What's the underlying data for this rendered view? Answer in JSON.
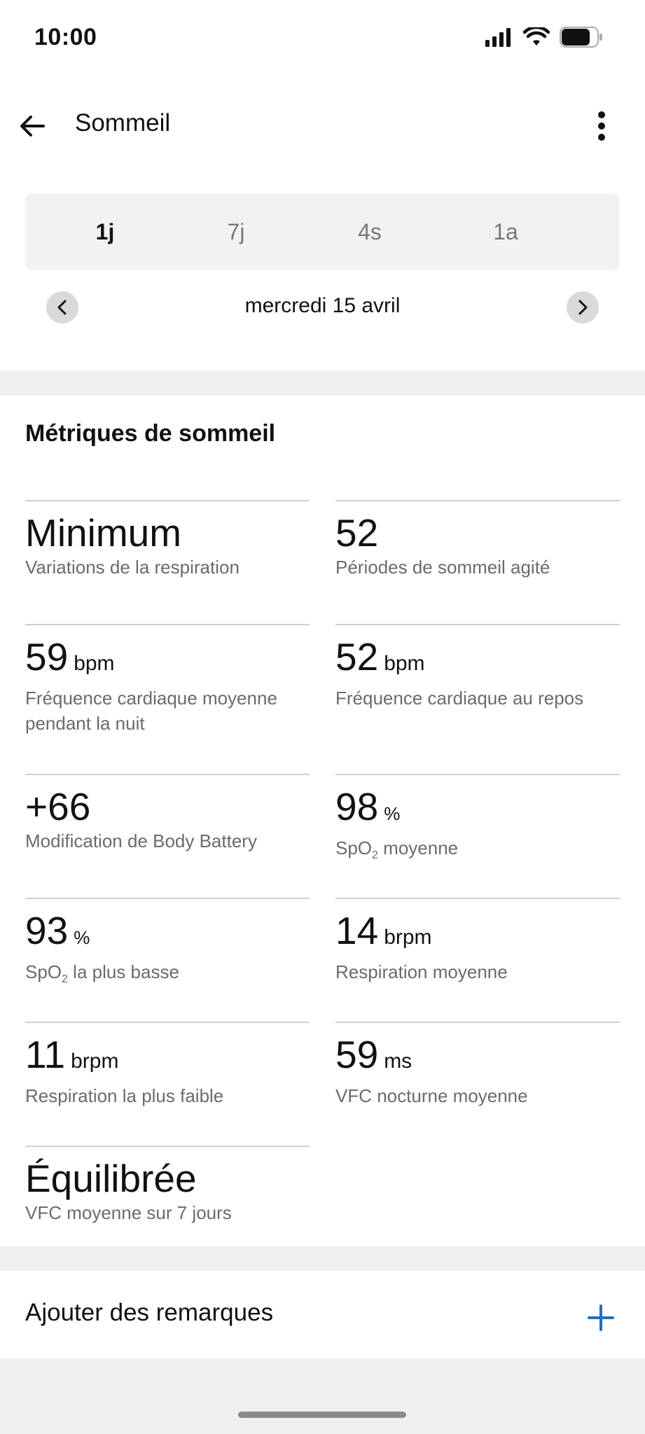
{
  "status_bar": {
    "time": "10:00"
  },
  "header": {
    "title": "Sommeil"
  },
  "periods": [
    {
      "label": "1j",
      "active": true
    },
    {
      "label": "7j",
      "active": false
    },
    {
      "label": "4s",
      "active": false
    },
    {
      "label": "1a",
      "active": false
    }
  ],
  "date_nav": {
    "date": "mercredi 15 avril"
  },
  "section": {
    "title": "Métriques de sommeil"
  },
  "metrics": [
    {
      "value": "Minimum",
      "unit": "",
      "label": "Variations de la respiration"
    },
    {
      "value": "52",
      "unit": "",
      "label": "Périodes de sommeil agité"
    },
    {
      "value": "59",
      "unit": "bpm",
      "label": "Fréquence cardiaque moyenne pendant la nuit"
    },
    {
      "value": "52",
      "unit": "bpm",
      "label": "Fréquence cardiaque au repos"
    },
    {
      "value": "+66",
      "unit": "",
      "label": "Modification de Body Battery"
    },
    {
      "value": "98",
      "unit": "%",
      "label_pre": "SpO",
      "label_sub": "2",
      "label_post": " moyenne"
    },
    {
      "value": "93",
      "unit": "%",
      "label_pre": "SpO",
      "label_sub": "2",
      "label_post": " la plus basse"
    },
    {
      "value": "14",
      "unit": "brpm",
      "label": "Respiration moyenne"
    },
    {
      "value": "11",
      "unit": "brpm",
      "label": "Respiration la plus faible"
    },
    {
      "value": "59",
      "unit": "ms",
      "label": "VFC nocturne moyenne"
    },
    {
      "value": "Équilibrée",
      "unit": "",
      "label": "VFC moyenne sur 7 jours"
    }
  ],
  "notes": {
    "label": "Ajouter des remarques",
    "icon": "plus-icon"
  },
  "colors": {
    "accent": "#1f6fc0",
    "band": "#efefef"
  }
}
